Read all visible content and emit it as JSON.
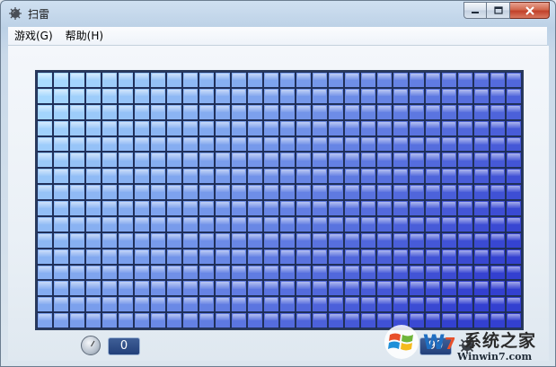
{
  "window": {
    "title": "扫雷"
  },
  "menu": {
    "items": [
      {
        "name": "menu-game",
        "label": "游戏(G)"
      },
      {
        "name": "menu-help",
        "label": "帮助(H)"
      }
    ]
  },
  "board": {
    "columns": 30,
    "rows": 16,
    "state": "all-covered",
    "colors": {
      "light": "#a9dcff",
      "dark": "#3340d0",
      "border": "#20305a"
    }
  },
  "status": {
    "timer_icon": "clock-icon",
    "timer_value": "0",
    "mines_value": "99",
    "mines_icon": "mine-icon"
  },
  "watermark": {
    "brand": "系统之家",
    "url": "Winwin7.com"
  },
  "colors": {
    "window_frame": "#bcd1e6",
    "close_button": "#c1412a",
    "counter_bg": "#23407a"
  }
}
